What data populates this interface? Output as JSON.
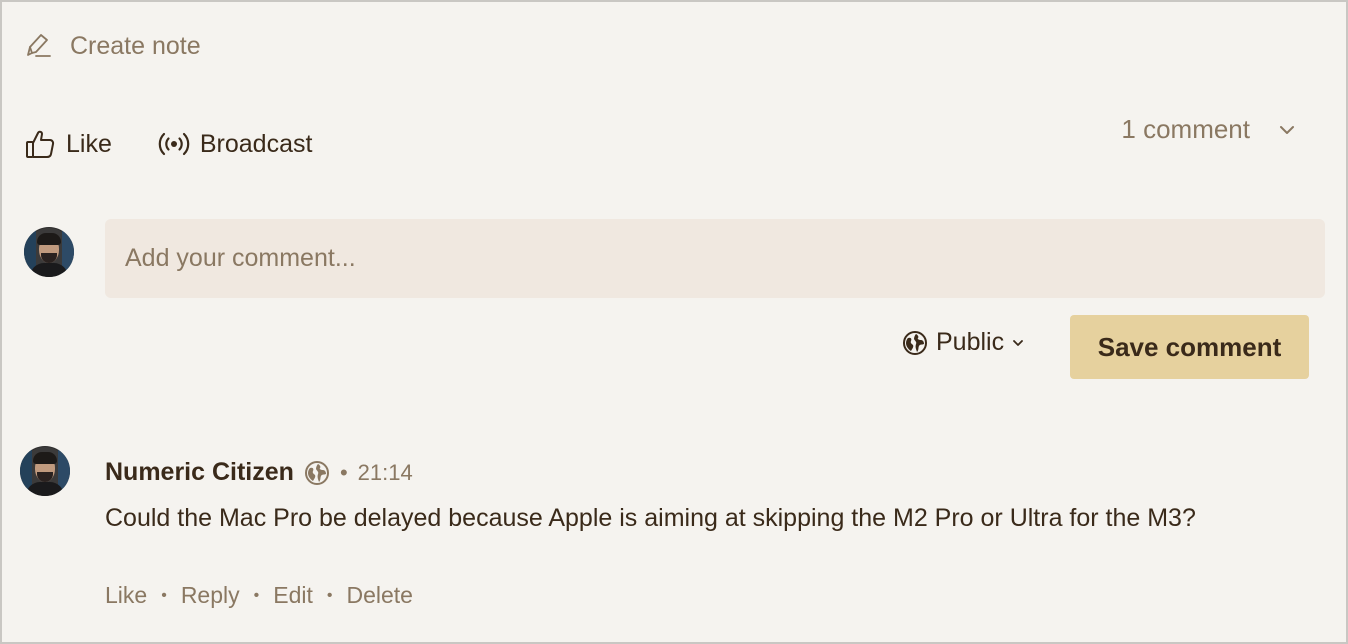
{
  "create_note": {
    "label": "Create note",
    "icon": "pen-icon"
  },
  "actions": {
    "like_label": "Like",
    "broadcast_label": "Broadcast"
  },
  "comments_summary": {
    "label": "1 comment"
  },
  "composer": {
    "placeholder": "Add your comment...",
    "visibility": "Public",
    "save_label": "Save comment"
  },
  "comment": {
    "author": "Numeric Citizen",
    "separator": "•",
    "time": "21:14",
    "text": "Could the Mac Pro be delayed because Apple is aiming at skipping the M2 Pro or Ultra for the M3?",
    "actions": [
      "Like",
      "Reply",
      "Edit",
      "Delete"
    ]
  },
  "colors": {
    "background": "#f5f3ef",
    "input_bg": "#f0e8e0",
    "button_bg": "#e6d19e",
    "text": "#3a2a1a",
    "muted": "#8a7862"
  }
}
